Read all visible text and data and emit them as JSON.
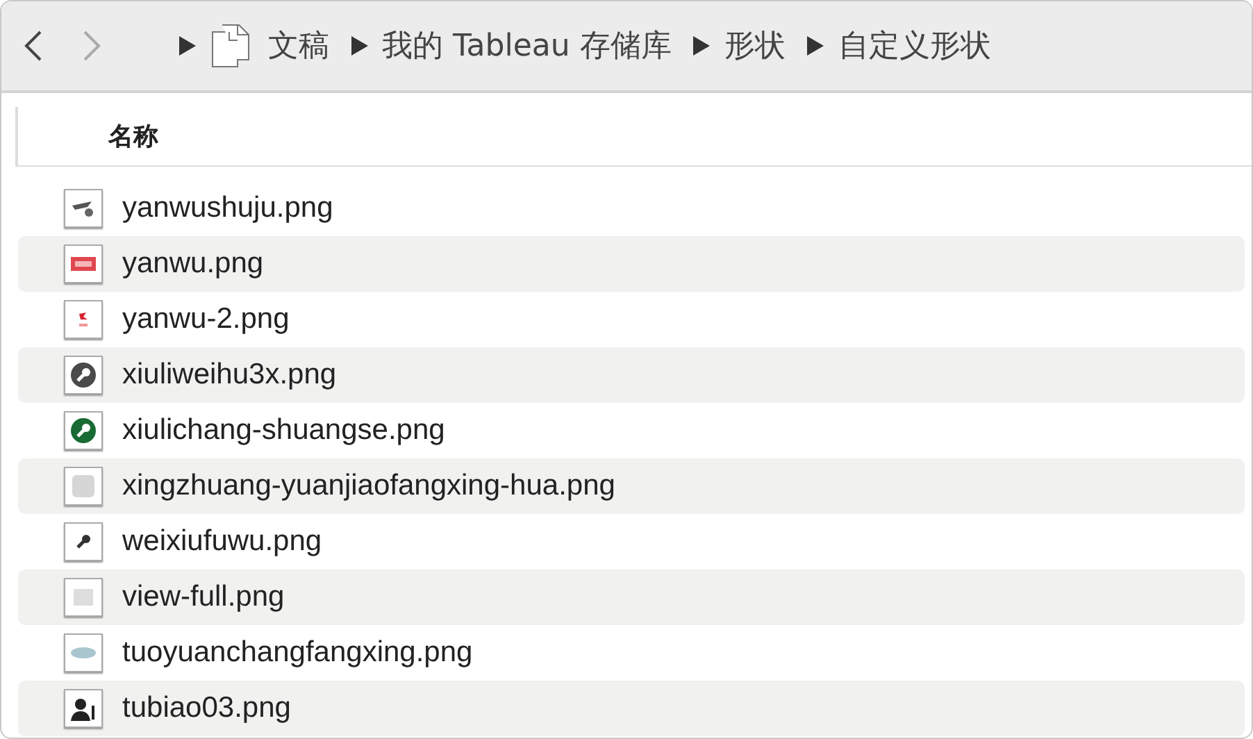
{
  "navigation": {
    "back": {
      "disabled": false
    },
    "forward": {
      "disabled": true
    }
  },
  "breadcrumb": [
    {
      "label": "文稿",
      "kind": "documents"
    },
    {
      "label": "我的 Tableau 存储库",
      "kind": "folder"
    },
    {
      "label": "形状",
      "kind": "folder"
    },
    {
      "label": "自定义形状",
      "kind": "folder"
    }
  ],
  "table": {
    "columns": [
      "名称"
    ],
    "rows": [
      {
        "name": "yanwushuju.png",
        "kind": "plane"
      },
      {
        "name": "yanwu.png",
        "kind": "red-label"
      },
      {
        "name": "yanwu-2.png",
        "kind": "red-mark"
      },
      {
        "name": "xiuliweihu3x.png",
        "kind": "wrench-dark"
      },
      {
        "name": "xiulichang-shuangse.png",
        "kind": "wrench-green"
      },
      {
        "name": "xingzhuang-yuanjiaofangxing-hua.png",
        "kind": "rounded-square"
      },
      {
        "name": "weixiufuwu.png",
        "kind": "wrench-small"
      },
      {
        "name": "view-full.png",
        "kind": "square"
      },
      {
        "name": "tuoyuanchangfangxing.png",
        "kind": "ellipse"
      },
      {
        "name": "tubiao03.png",
        "kind": "person"
      }
    ]
  }
}
